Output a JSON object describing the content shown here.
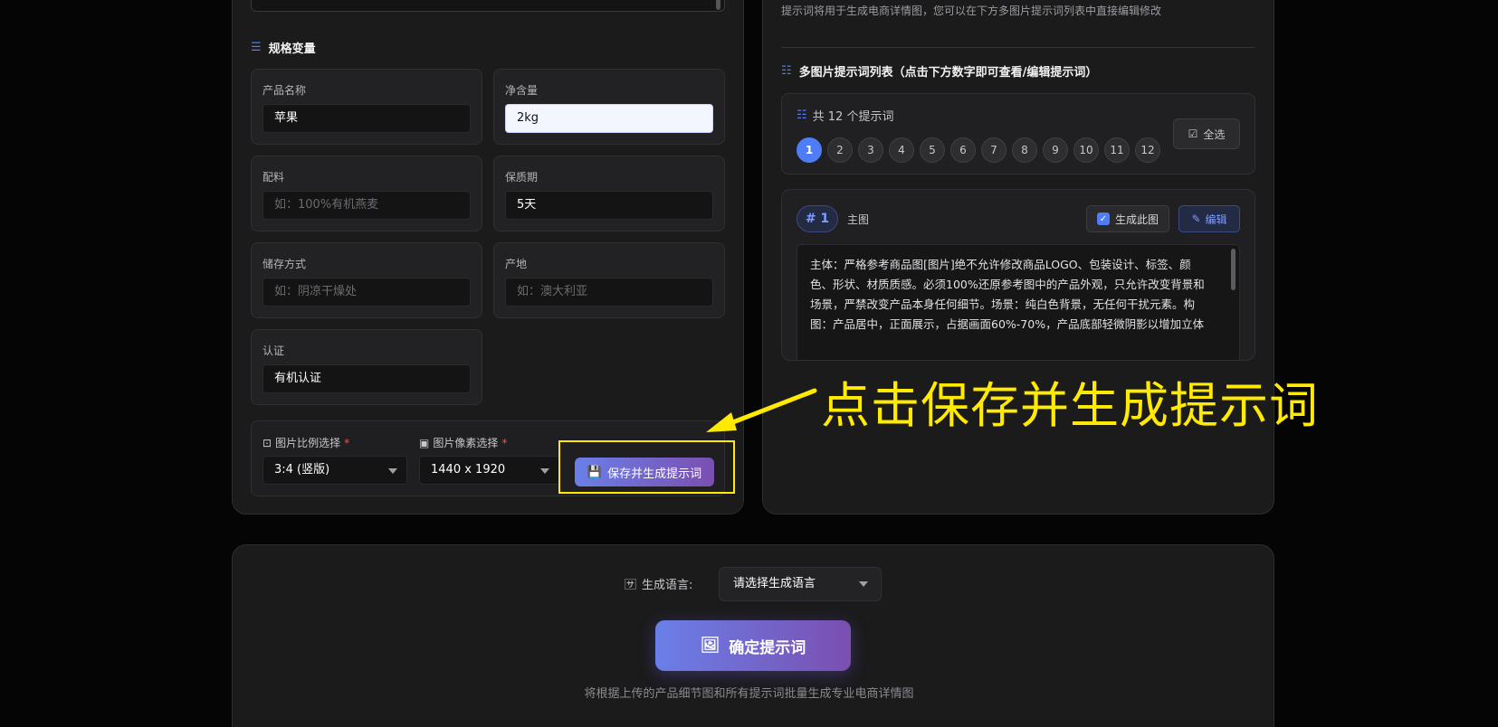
{
  "colors": {
    "accent": "#4f7cf7",
    "annotation": "#ffea00",
    "button_gradient_start": "#6a7fe8",
    "button_gradient_end": "#7b4fb0"
  },
  "left": {
    "section_title": "规格变量",
    "section_icon": "sliders-icon",
    "fields": [
      {
        "label": "产品名称",
        "value": "苹果",
        "placeholder": ""
      },
      {
        "label": "净含量",
        "value": "2kg",
        "placeholder": ""
      },
      {
        "label": "配料",
        "value": "",
        "placeholder": "如：100%有机燕麦"
      },
      {
        "label": "保质期",
        "value": "5天",
        "placeholder": ""
      },
      {
        "label": "储存方式",
        "value": "",
        "placeholder": "如：阴凉干燥处"
      },
      {
        "label": "产地",
        "value": "",
        "placeholder": "如：澳大利亚"
      },
      {
        "label": "认证",
        "value": "有机认证",
        "placeholder": ""
      }
    ],
    "options": {
      "ratio_label": "图片比例选择",
      "ratio_value": "3:4 (竖版)",
      "pixel_label": "图片像素选择",
      "pixel_value": "1440 x 1920",
      "required_mark": "*",
      "save_button": "保存并生成提示词"
    }
  },
  "right": {
    "hint": "提示词将用于生成电商详情图，您可以在下方多图片提示词列表中直接编辑修改",
    "list_title": "多图片提示词列表（点击下方数字即可查看/编辑提示词）",
    "count_label": "共 12 个提示词",
    "numbers": [
      "1",
      "2",
      "3",
      "4",
      "5",
      "6",
      "7",
      "8",
      "9",
      "10",
      "11",
      "12"
    ],
    "active_index": 0,
    "select_all": "全选",
    "card": {
      "badge": "# 1",
      "type": "主图",
      "generate_label": "生成此图",
      "edit_label": "编辑",
      "text_lines": [
        "主体：严格参考商品图[图片]绝不允许修改商品LOGO、包装设计、标签、颜",
        "色、形状、材质质感。必须100%还原参考图中的产品外观，只允许改变背景和",
        "场景，严禁改变产品本身任何细节。场景：纯白色背景，无任何干扰元素。构",
        "图：产品居中，正面展示，占据画面60%-70%，产品底部轻微阴影以增加立体"
      ]
    }
  },
  "annotation": {
    "text": "点击保存并生成提示词"
  },
  "bottom": {
    "lang_label": "生成语言:",
    "lang_select": "请选择生成语言",
    "confirm_button": "确定提示词",
    "footnote": "将根据上传的产品细节图和所有提示词批量生成专业电商详情图"
  }
}
